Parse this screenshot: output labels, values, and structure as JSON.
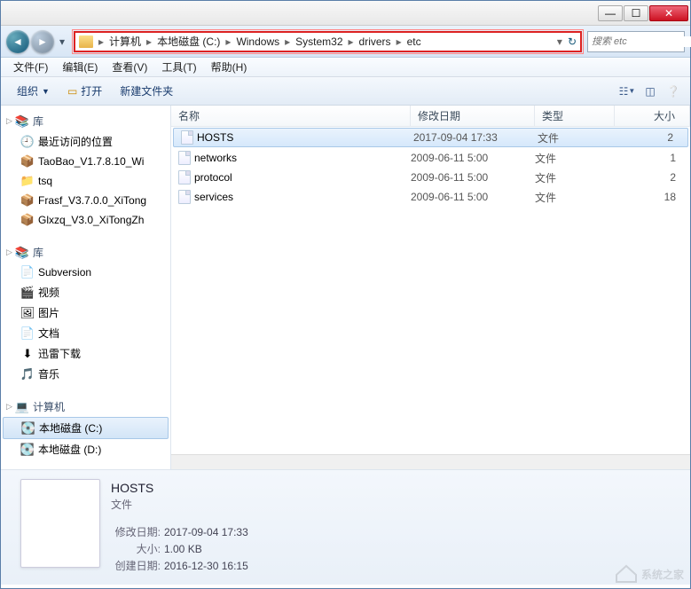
{
  "window": {
    "min": "—",
    "max": "☐",
    "close": "✕"
  },
  "breadcrumb": [
    "计算机",
    "本地磁盘 (C:)",
    "Windows",
    "System32",
    "drivers",
    "etc"
  ],
  "search": {
    "placeholder": "搜索 etc"
  },
  "menus": [
    "文件(F)",
    "编辑(E)",
    "查看(V)",
    "工具(T)",
    "帮助(H)"
  ],
  "toolbar": {
    "organize": "组织",
    "open": "打开",
    "newfolder": "新建文件夹"
  },
  "sidebar": {
    "favorites": {
      "label": "库",
      "items": [
        "最近访问的位置",
        "TaoBao_V1.7.8.10_Wi",
        "tsq",
        "Frasf_V3.7.0.0_XiTong",
        "Glxzq_V3.0_XiTongZh"
      ]
    },
    "libraries": {
      "label": "库",
      "items": [
        "Subversion",
        "视频",
        "图片",
        "文档",
        "迅雷下载",
        "音乐"
      ]
    },
    "computer": {
      "label": "计算机",
      "items": [
        "本地磁盘 (C:)",
        "本地磁盘 (D:)"
      ]
    }
  },
  "columns": {
    "name": "名称",
    "date": "修改日期",
    "type": "类型",
    "size": "大小"
  },
  "files": [
    {
      "name": "HOSTS",
      "date": "2017-09-04 17:33",
      "type": "文件",
      "size": "2",
      "selected": true
    },
    {
      "name": "networks",
      "date": "2009-06-11 5:00",
      "type": "文件",
      "size": "1"
    },
    {
      "name": "protocol",
      "date": "2009-06-11 5:00",
      "type": "文件",
      "size": "2"
    },
    {
      "name": "services",
      "date": "2009-06-11 5:00",
      "type": "文件",
      "size": "18"
    }
  ],
  "details": {
    "name": "HOSTS",
    "type": "文件",
    "meta": [
      {
        "label": "修改日期:",
        "value": "2017-09-04 17:33"
      },
      {
        "label": "大小:",
        "value": "1.00 KB"
      },
      {
        "label": "创建日期:",
        "value": "2016-12-30 16:15"
      }
    ]
  },
  "watermark": "系统之家"
}
